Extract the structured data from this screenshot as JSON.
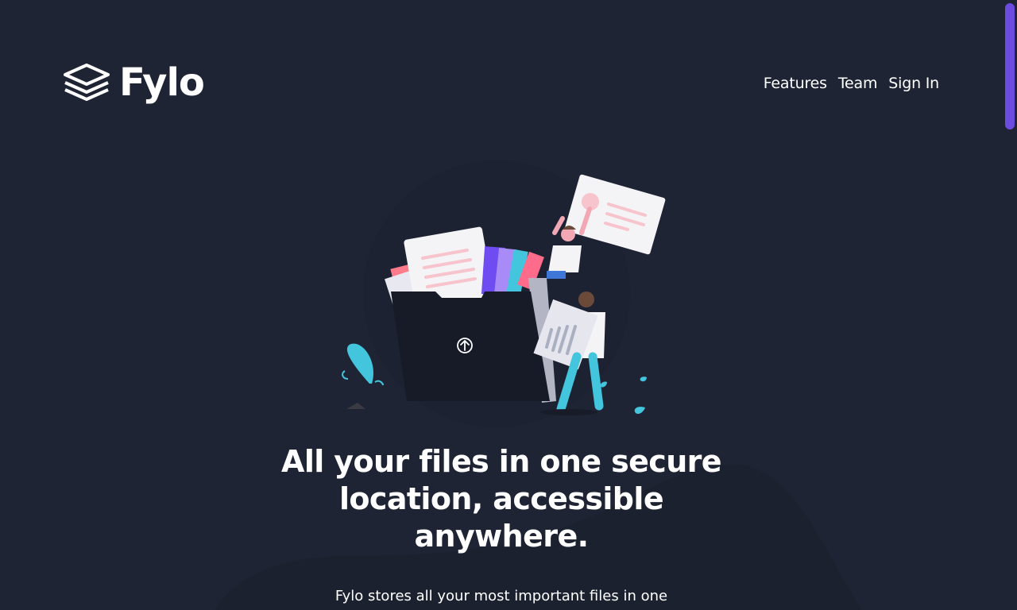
{
  "brand": {
    "name": "Fylo",
    "logo_icon": "stacked-layers-icon"
  },
  "nav": {
    "items": [
      {
        "label": "Features"
      },
      {
        "label": "Team"
      },
      {
        "label": "Sign In"
      }
    ]
  },
  "hero": {
    "illustration": "people-uploading-files-into-folder-illustration",
    "headline": "All your files in one secure location, accessible anywhere.",
    "description": "Fylo stores all your most important files in one secure"
  },
  "colors": {
    "background": "#1f2434",
    "curve_shape": "#1c2130",
    "scrollbar_thumb": "#6c4be0",
    "text": "#ffffff"
  }
}
